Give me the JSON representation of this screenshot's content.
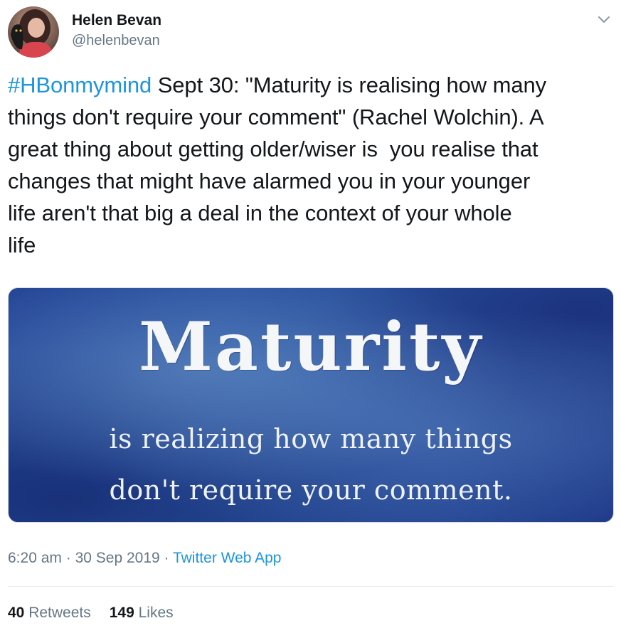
{
  "author": {
    "name": "Helen Bevan",
    "handle": "@helenbevan"
  },
  "tweet": {
    "hashtag": "#HBonmymind",
    "body": " Sept 30: \"Maturity is realising how many\nthings don't require your comment\" (Rachel Wolchin). A\ngreat thing about getting older/wiser is  you realise that\nchanges that might have alarmed you in your younger\nlife aren't that big a deal in the context of your whole\nlife"
  },
  "media": {
    "title": "Maturity",
    "line1": "is realizing how many things",
    "line2": "don't require your comment."
  },
  "meta": {
    "time": "6:20 am",
    "separator1": " · ",
    "date": "30 Sep 2019",
    "separator2": " · ",
    "source": "Twitter Web App"
  },
  "stats": {
    "retweets_count": "40",
    "retweets_label": " Retweets",
    "likes_count": "149",
    "likes_label": " Likes"
  },
  "colors": {
    "link": "#1b95e0",
    "secondary": "#657786",
    "primary": "#14171a"
  },
  "icons": {
    "caret": "chevron-down-icon"
  }
}
